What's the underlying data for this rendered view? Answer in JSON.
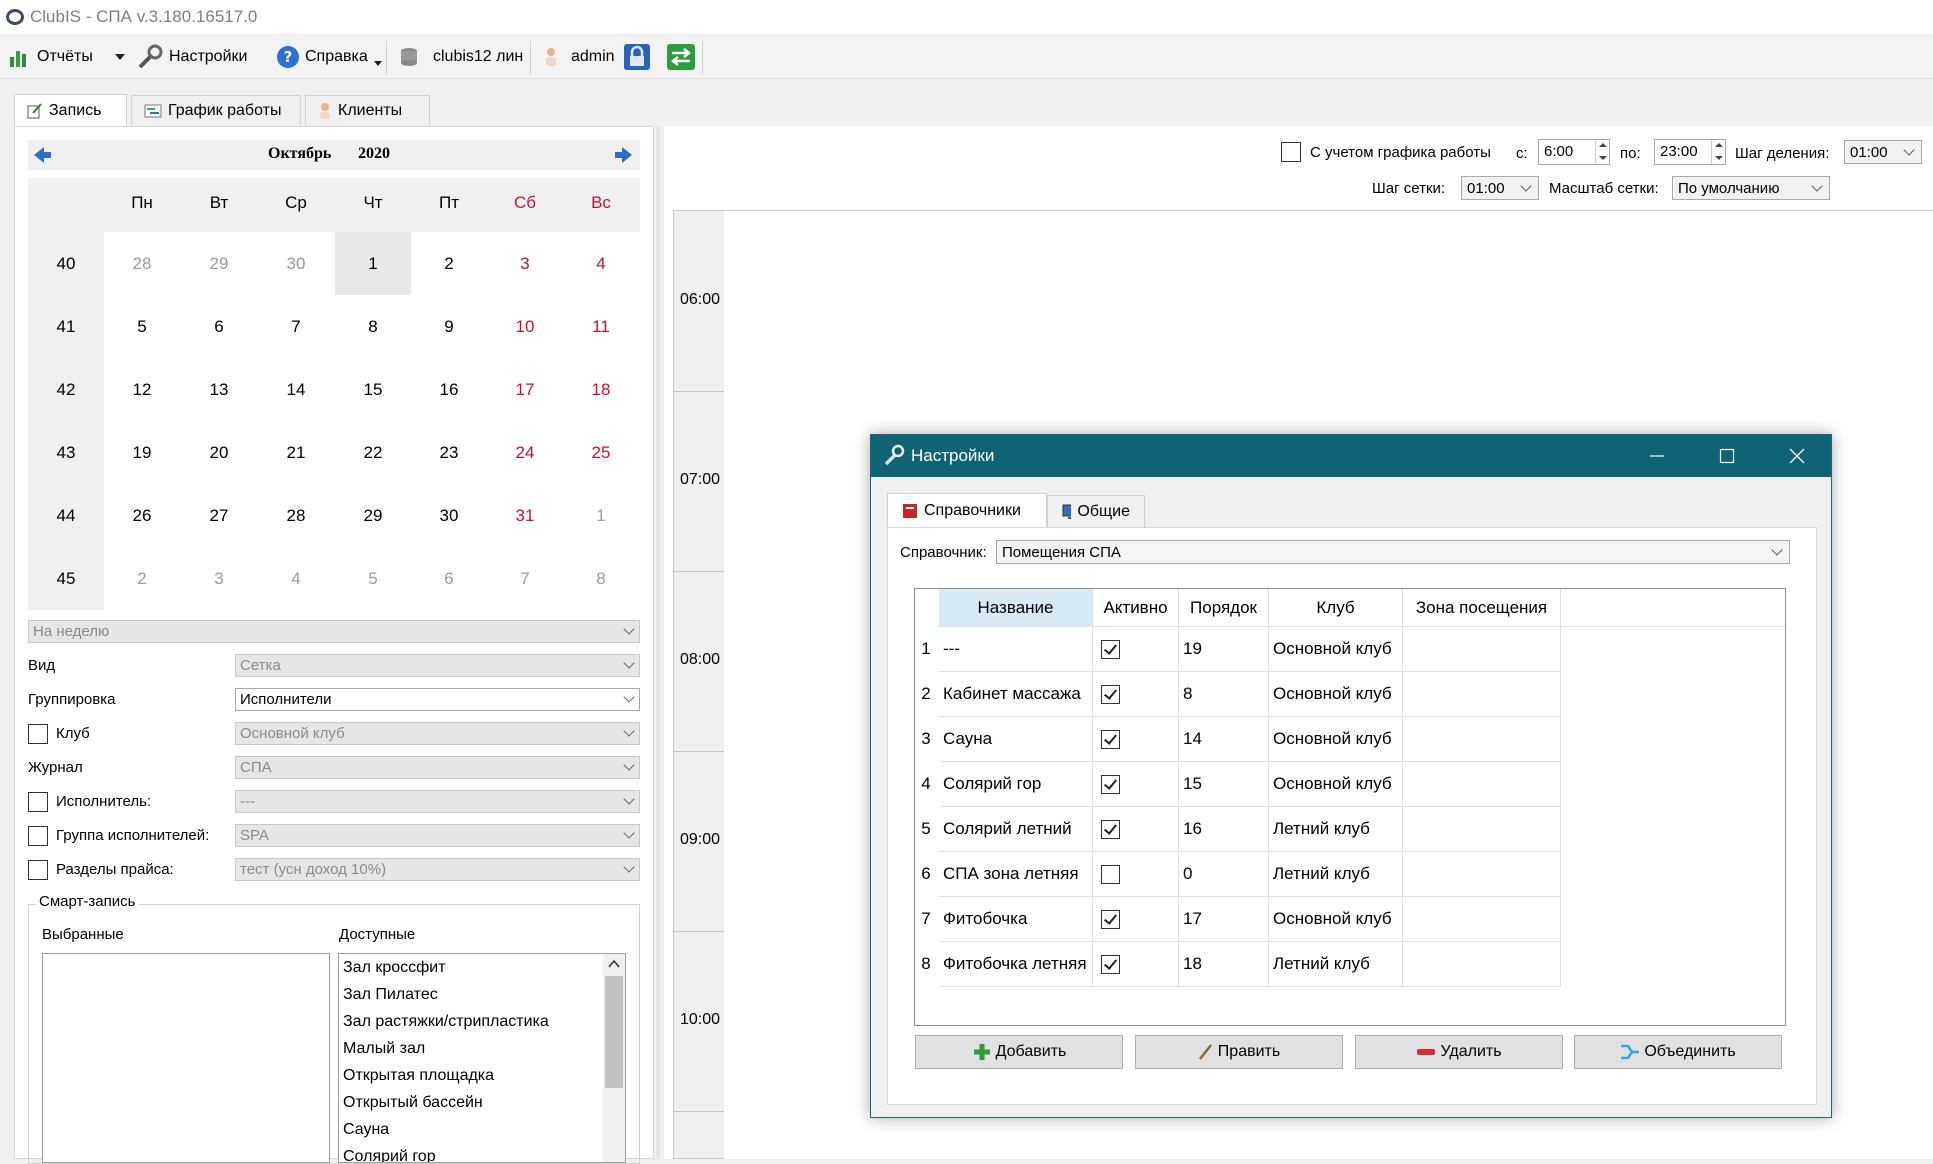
{
  "window": {
    "title": "ClubIS - СПА v.3.180.16517.0"
  },
  "toolbar": {
    "reports": "Отчёты",
    "settings": "Настройки",
    "help": "Справка",
    "db": "clubis12 лин",
    "user": "admin"
  },
  "left_tabs": [
    "Запись",
    "График работы",
    "Клиенты"
  ],
  "calendar": {
    "month": "Октябрь",
    "year": "2020",
    "weekdays": [
      "Пн",
      "Вт",
      "Ср",
      "Чт",
      "Пт",
      "Сб",
      "Вс"
    ],
    "weeks": [
      {
        "num": "40",
        "days": [
          "28",
          "29",
          "30",
          "1",
          "2",
          "3",
          "4"
        ]
      },
      {
        "num": "41",
        "days": [
          "5",
          "6",
          "7",
          "8",
          "9",
          "10",
          "11"
        ]
      },
      {
        "num": "42",
        "days": [
          "12",
          "13",
          "14",
          "15",
          "16",
          "17",
          "18"
        ]
      },
      {
        "num": "43",
        "days": [
          "19",
          "20",
          "21",
          "22",
          "23",
          "24",
          "25"
        ]
      },
      {
        "num": "44",
        "days": [
          "26",
          "27",
          "28",
          "29",
          "30",
          "31",
          "1"
        ]
      },
      {
        "num": "45",
        "days": [
          "2",
          "3",
          "4",
          "5",
          "6",
          "7",
          "8"
        ]
      }
    ]
  },
  "filters": {
    "period": "На неделю",
    "view_label": "Вид",
    "view_value": "Сетка",
    "group_label": "Группировка",
    "group_value": "Исполнители",
    "club_label": "Клуб",
    "club_value": "Основной клуб",
    "journal_label": "Журнал",
    "journal_value": "СПА",
    "performer_label": "Исполнитель:",
    "performer_value": "---",
    "pgroup_label": "Группа исполнителей:",
    "pgroup_value": "SPA",
    "price_label": "Разделы прайса:",
    "price_value": "тест (усн доход 10%)"
  },
  "smart": {
    "legend": "Смарт-запись",
    "selected_label": "Выбранные",
    "available_label": "Доступные",
    "available": [
      "Зал кроссфит",
      "Зал Пилатес",
      "Зал растяжки/стрипластика",
      "Малый зал",
      "Открытая площадка",
      "Открытый бассейн",
      "Сауна",
      "Солярий гор"
    ]
  },
  "schedule": {
    "consider_label": "С учетом графика работы",
    "from_label": "с:",
    "from_value": "6:00",
    "to_label": "по:",
    "to_value": "23:00",
    "step_label": "Шаг деления:",
    "step_value": "01:00",
    "grid_step_label": "Шаг сетки:",
    "grid_step_value": "01:00",
    "scale_label": "Масштаб сетки:",
    "scale_value": "По умолчанию",
    "hours": [
      "06:00",
      "07:00",
      "08:00",
      "09:00",
      "10:00"
    ]
  },
  "dialog": {
    "title": "Настройки",
    "tabs": [
      "Справочники",
      "Общие"
    ],
    "ref_label": "Справочник:",
    "ref_value": "Помещения СПА",
    "columns": [
      "Название",
      "Активно",
      "Порядок",
      "Клуб",
      "Зона посещения"
    ],
    "rows": [
      {
        "n": "1",
        "name": "---",
        "active": true,
        "order": "19",
        "club": "Основной клуб",
        "zone": ""
      },
      {
        "n": "2",
        "name": "Кабинет массажа",
        "active": true,
        "order": "8",
        "club": "Основной клуб",
        "zone": ""
      },
      {
        "n": "3",
        "name": "Сауна",
        "active": true,
        "order": "14",
        "club": "Основной клуб",
        "zone": ""
      },
      {
        "n": "4",
        "name": "Солярий гор",
        "active": true,
        "order": "15",
        "club": "Основной клуб",
        "zone": ""
      },
      {
        "n": "5",
        "name": "Солярий летний",
        "active": true,
        "order": "16",
        "club": "Летний клуб",
        "zone": ""
      },
      {
        "n": "6",
        "name": "СПА зона летняя",
        "active": false,
        "order": "0",
        "club": "Летний клуб",
        "zone": ""
      },
      {
        "n": "7",
        "name": "Фитобочка",
        "active": true,
        "order": "17",
        "club": "Основной клуб",
        "zone": ""
      },
      {
        "n": "8",
        "name": "Фитобочка летняя",
        "active": true,
        "order": "18",
        "club": "Летний клуб",
        "zone": ""
      }
    ],
    "buttons": [
      "Добавить",
      "Править",
      "Удалить",
      "Объединить"
    ]
  },
  "colors": {
    "dialog_title": "#0f6374",
    "weekend": "#c8102e"
  }
}
